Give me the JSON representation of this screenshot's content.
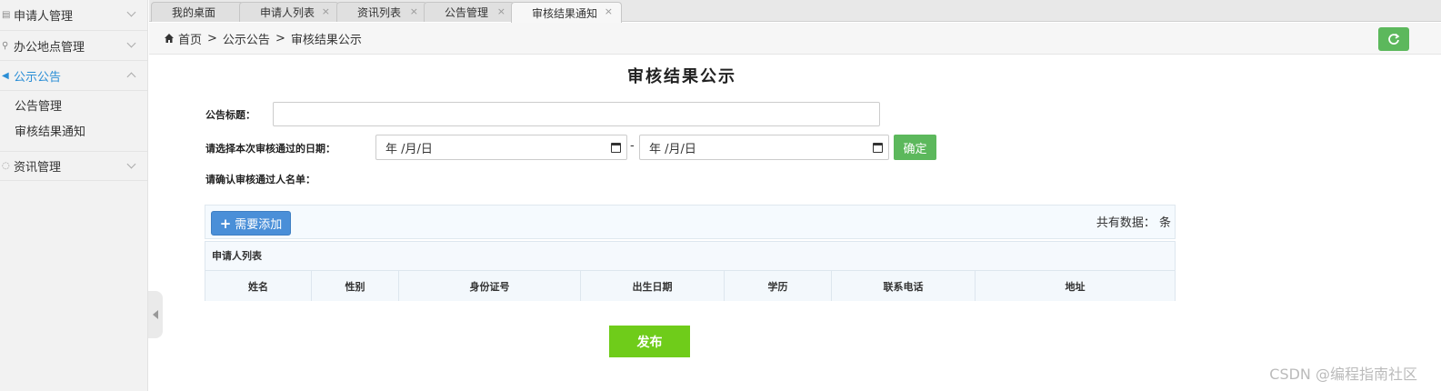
{
  "sidebar": {
    "items": [
      {
        "label": "申请人管理",
        "icon": "users-icon",
        "expanded": false
      },
      {
        "label": "办公地点管理",
        "icon": "location-pin-icon",
        "expanded": false
      },
      {
        "label": "公示公告",
        "icon": "speaker-icon",
        "expanded": true,
        "children": [
          "公告管理",
          "审核结果通知"
        ]
      },
      {
        "label": "资讯管理",
        "icon": "chat-bubble-icon",
        "expanded": false
      }
    ]
  },
  "tabs": [
    {
      "label": "我的桌面",
      "closable": false
    },
    {
      "label": "申请人列表",
      "closable": true
    },
    {
      "label": "资讯列表",
      "closable": true
    },
    {
      "label": "公告管理",
      "closable": true
    },
    {
      "label": "审核结果通知",
      "closable": true,
      "active": true
    }
  ],
  "tab_close_glyph": "×",
  "breadcrumb": {
    "home": "首页",
    "sep": ">",
    "level1": "公示公告",
    "level2": "审核结果公示"
  },
  "page": {
    "title": "审核结果公示",
    "title_label": "公告标题：",
    "title_value": "",
    "date_label": "请选择本次审核通过的日期：",
    "date_from_placeholder": "年 /月/日",
    "date_to_placeholder": "年 /月/日",
    "date_sep": "-",
    "confirm_label": "确定",
    "confirm_list_label": "请确认审核通过人名单：",
    "add_label": "需要添加",
    "total_label": "共有数据： 条",
    "list_title": "申请人列表",
    "columns": [
      "姓名",
      "性别",
      "身份证号",
      "出生日期",
      "学历",
      "联系电话",
      "地址"
    ],
    "publish_label": "发布"
  },
  "watermark": "CSDN @编程指南社区",
  "colors": {
    "green": "#5cb85c",
    "blue": "#4a8fd8",
    "publish_green": "#6fcc1a",
    "active_blue": "#2a8ed6"
  }
}
